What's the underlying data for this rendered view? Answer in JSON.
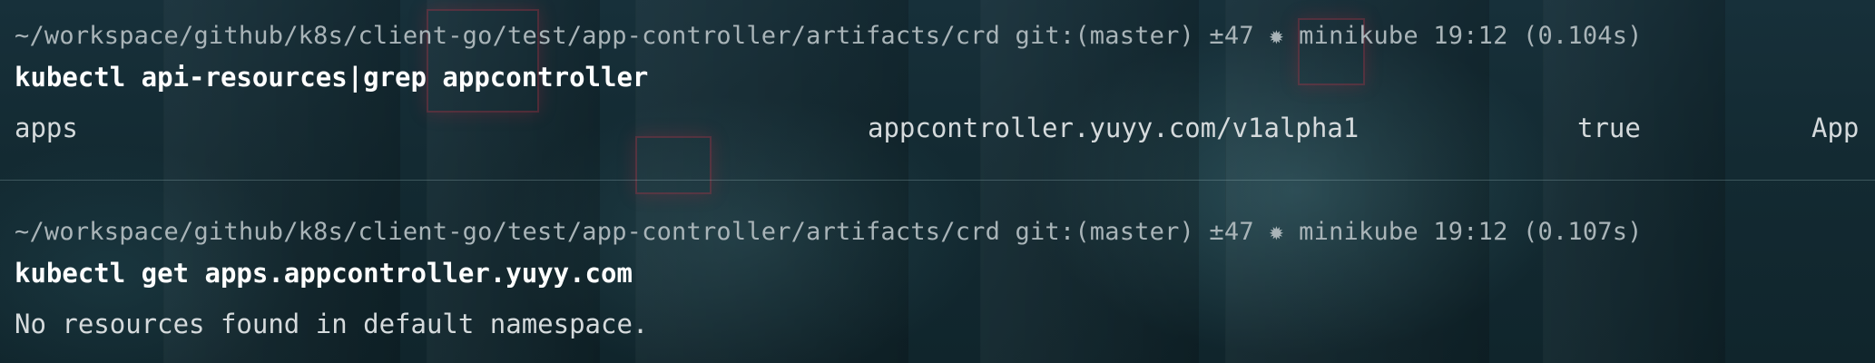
{
  "terminal": {
    "blocks": [
      {
        "prompt": "~/workspace/github/k8s/client-go/test/app-controller/artifacts/crd git:(master) ±47 ✹ minikube 19:12 (0.104s)",
        "command": "kubectl api-resources|grep appcontroller",
        "output_columns": [
          "apps",
          "appcontroller.yuyy.com/v1alpha1",
          "true",
          "App"
        ]
      },
      {
        "prompt": "~/workspace/github/k8s/client-go/test/app-controller/artifacts/crd git:(master) ±47 ✹ minikube 19:12 (0.107s)",
        "command": "kubectl get apps.appcontroller.yuyy.com",
        "output": "No resources found in default namespace."
      }
    ]
  },
  "colors": {
    "background": "#14252b",
    "prompt_text": "#a9b4b8",
    "command_text": "#ffffff",
    "output_text": "#d5dadc",
    "divider": "#9cc8cd"
  }
}
